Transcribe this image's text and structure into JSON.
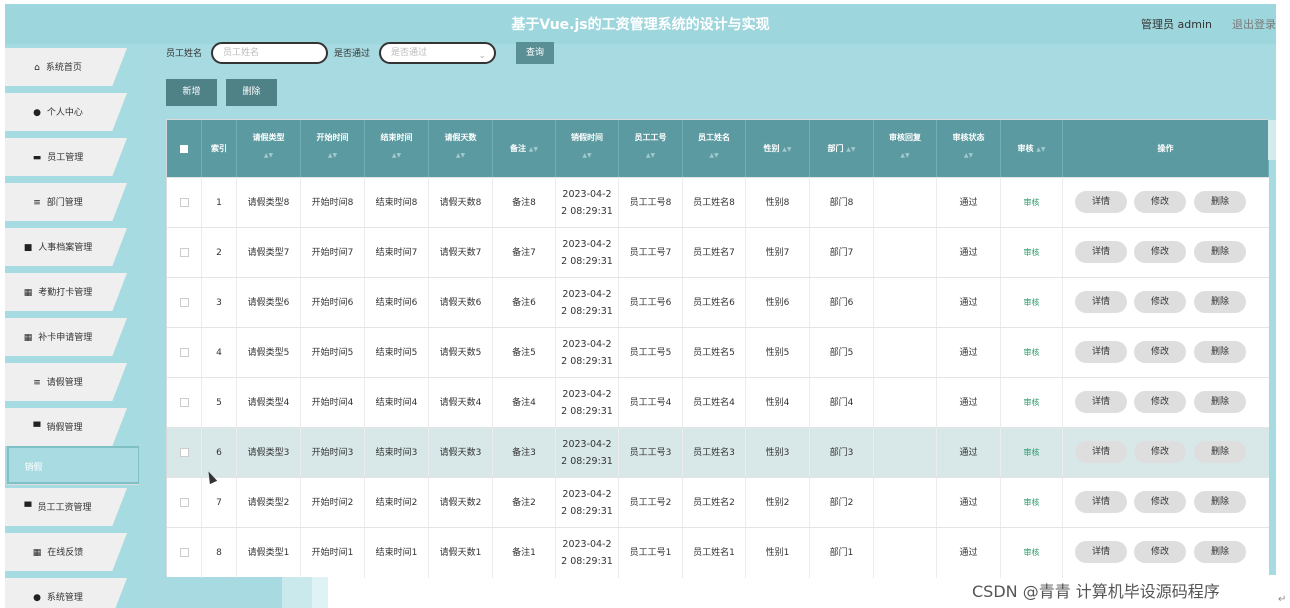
{
  "header": {
    "title": "基于Vue.js的工资管理系统的设计与实现",
    "user": "管理员 admin",
    "logout": "退出登录"
  },
  "sidebar": {
    "items": [
      {
        "label": "系统首页",
        "icon": "home-icon",
        "glyph": "⌂"
      },
      {
        "label": "个人中心",
        "icon": "user-icon",
        "glyph": "●"
      },
      {
        "label": "员工管理",
        "icon": "briefcase-icon",
        "glyph": "▬"
      },
      {
        "label": "部门管理",
        "icon": "list-icon",
        "glyph": "≡"
      },
      {
        "label": "人事档案管理",
        "icon": "document-icon",
        "glyph": "■"
      },
      {
        "label": "考勤打卡管理",
        "icon": "grid-icon",
        "glyph": "▦"
      },
      {
        "label": "补卡申请管理",
        "icon": "grid-icon",
        "glyph": "▦"
      },
      {
        "label": "请假管理",
        "icon": "list-icon",
        "glyph": "≡"
      },
      {
        "label": "销假管理",
        "icon": "monitor-icon",
        "glyph": "▀"
      },
      {
        "label": "销假",
        "icon": "",
        "glyph": ""
      },
      {
        "label": "员工工资管理",
        "icon": "monitor-icon",
        "glyph": "▀"
      },
      {
        "label": "在线反馈",
        "icon": "grid-icon",
        "glyph": "▦"
      },
      {
        "label": "系统管理",
        "icon": "location-icon",
        "glyph": "●"
      }
    ],
    "active_index": 9
  },
  "search": {
    "name_label": "员工姓名",
    "name_placeholder": "员工姓名",
    "pass_label": "是否通过",
    "pass_placeholder": "是否通过",
    "query_label": "查询"
  },
  "actions": {
    "add_label": "新增",
    "delete_label": "删除"
  },
  "table": {
    "headers": [
      "索引",
      "请假类型",
      "开始时间",
      "结束时间",
      "请假天数",
      "备注",
      "销假时间",
      "员工工号",
      "员工姓名",
      "性别",
      "部门",
      "审核回复",
      "审核状态",
      "审核",
      "操作"
    ],
    "sort_glyph": "▲▼",
    "rows": [
      {
        "index": "1",
        "type": "请假类型8",
        "start": "开始时间8",
        "end": "结束时间8",
        "days": "请假天数8",
        "note": "备注8",
        "time1": "2023-04-2",
        "time2": "2 08:29:31",
        "emp_no": "员工工号8",
        "emp_name": "员工姓名8",
        "gender": "性别8",
        "dept": "部门8",
        "reply": "",
        "status": "通过",
        "audit": "审核"
      },
      {
        "index": "2",
        "type": "请假类型7",
        "start": "开始时间7",
        "end": "结束时间7",
        "days": "请假天数7",
        "note": "备注7",
        "time1": "2023-04-2",
        "time2": "2 08:29:31",
        "emp_no": "员工工号7",
        "emp_name": "员工姓名7",
        "gender": "性别7",
        "dept": "部门7",
        "reply": "",
        "status": "通过",
        "audit": "审核"
      },
      {
        "index": "3",
        "type": "请假类型6",
        "start": "开始时间6",
        "end": "结束时间6",
        "days": "请假天数6",
        "note": "备注6",
        "time1": "2023-04-2",
        "time2": "2 08:29:31",
        "emp_no": "员工工号6",
        "emp_name": "员工姓名6",
        "gender": "性别6",
        "dept": "部门6",
        "reply": "",
        "status": "通过",
        "audit": "审核"
      },
      {
        "index": "4",
        "type": "请假类型5",
        "start": "开始时间5",
        "end": "结束时间5",
        "days": "请假天数5",
        "note": "备注5",
        "time1": "2023-04-2",
        "time2": "2 08:29:31",
        "emp_no": "员工工号5",
        "emp_name": "员工姓名5",
        "gender": "性别5",
        "dept": "部门5",
        "reply": "",
        "status": "通过",
        "audit": "审核"
      },
      {
        "index": "5",
        "type": "请假类型4",
        "start": "开始时间4",
        "end": "结束时间4",
        "days": "请假天数4",
        "note": "备注4",
        "time1": "2023-04-2",
        "time2": "2 08:29:31",
        "emp_no": "员工工号4",
        "emp_name": "员工姓名4",
        "gender": "性别4",
        "dept": "部门4",
        "reply": "",
        "status": "通过",
        "audit": "审核"
      },
      {
        "index": "6",
        "type": "请假类型3",
        "start": "开始时间3",
        "end": "结束时间3",
        "days": "请假天数3",
        "note": "备注3",
        "time1": "2023-04-2",
        "time2": "2 08:29:31",
        "emp_no": "员工工号3",
        "emp_name": "员工姓名3",
        "gender": "性别3",
        "dept": "部门3",
        "reply": "",
        "status": "通过",
        "audit": "审核"
      },
      {
        "index": "7",
        "type": "请假类型2",
        "start": "开始时间2",
        "end": "结束时间2",
        "days": "请假天数2",
        "note": "备注2",
        "time1": "2023-04-2",
        "time2": "2 08:29:31",
        "emp_no": "员工工号2",
        "emp_name": "员工姓名2",
        "gender": "性别2",
        "dept": "部门2",
        "reply": "",
        "status": "通过",
        "audit": "审核"
      },
      {
        "index": "8",
        "type": "请假类型1",
        "start": "开始时间1",
        "end": "结束时间1",
        "days": "请假天数1",
        "note": "备注1",
        "time1": "2023-04-2",
        "time2": "2 08:29:31",
        "emp_no": "员工工号1",
        "emp_name": "员工姓名1",
        "gender": "性别1",
        "dept": "部门1",
        "reply": "",
        "status": "通过",
        "audit": "审核"
      }
    ],
    "highlight_row": 5,
    "ops": [
      "详情",
      "修改",
      "删除"
    ]
  },
  "watermark": "CSDN @青青  计算机毕设源码程序",
  "colors": {
    "header_bg": "#9ed6dd",
    "table_header": "#5a9aa0",
    "btn_dark": "#4e8287",
    "audit_green": "#2b9a6a"
  }
}
